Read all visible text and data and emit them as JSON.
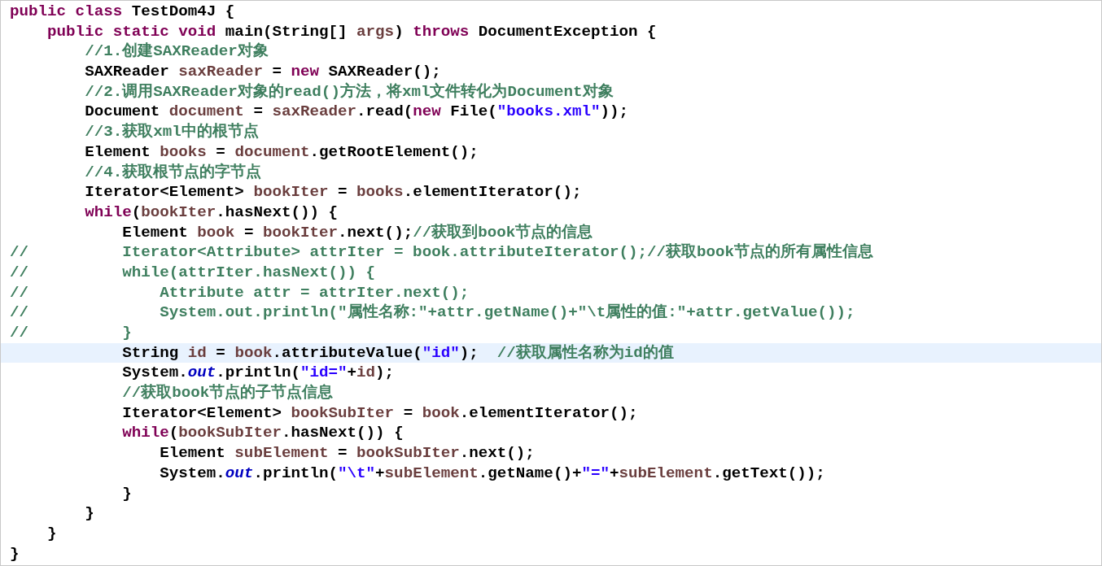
{
  "editor": {
    "lines": [
      {
        "current": false,
        "tokens": [
          {
            "kind": "keyword",
            "text": "public "
          },
          {
            "kind": "keyword",
            "text": "class"
          },
          {
            "kind": "plain",
            "text": " TestDom4J {"
          }
        ]
      },
      {
        "current": false,
        "tokens": [
          {
            "kind": "keyword",
            "text": "    public "
          },
          {
            "kind": "keyword",
            "text": "static "
          },
          {
            "kind": "keyword",
            "text": "void"
          },
          {
            "kind": "plain",
            "text": " main(String[] "
          },
          {
            "kind": "variable",
            "text": "args"
          },
          {
            "kind": "plain",
            "text": ") "
          },
          {
            "kind": "keyword",
            "text": "throws"
          },
          {
            "kind": "plain",
            "text": " DocumentException {"
          }
        ]
      },
      {
        "current": false,
        "tokens": [
          {
            "kind": "comment",
            "text": "        //1.创建SAXReader对象"
          }
        ]
      },
      {
        "current": false,
        "tokens": [
          {
            "kind": "plain",
            "text": "        SAXReader "
          },
          {
            "kind": "variable",
            "text": "saxReader"
          },
          {
            "kind": "plain",
            "text": " = "
          },
          {
            "kind": "keyword",
            "text": "new"
          },
          {
            "kind": "plain",
            "text": " SAXReader();"
          }
        ]
      },
      {
        "current": false,
        "tokens": [
          {
            "kind": "comment",
            "text": "        //2.调用SAXReader对象的read()方法，将xml文件转化为Document对象"
          }
        ]
      },
      {
        "current": false,
        "tokens": [
          {
            "kind": "plain",
            "text": "        Document "
          },
          {
            "kind": "variable",
            "text": "document"
          },
          {
            "kind": "plain",
            "text": " = "
          },
          {
            "kind": "variable",
            "text": "saxReader"
          },
          {
            "kind": "plain",
            "text": ".read("
          },
          {
            "kind": "keyword",
            "text": "new"
          },
          {
            "kind": "plain",
            "text": " File("
          },
          {
            "kind": "string",
            "text": "\"books.xml\""
          },
          {
            "kind": "plain",
            "text": "));"
          }
        ]
      },
      {
        "current": false,
        "tokens": [
          {
            "kind": "comment",
            "text": "        //3.获取xml中的根节点"
          }
        ]
      },
      {
        "current": false,
        "tokens": [
          {
            "kind": "plain",
            "text": "        Element "
          },
          {
            "kind": "variable",
            "text": "books"
          },
          {
            "kind": "plain",
            "text": " = "
          },
          {
            "kind": "variable",
            "text": "document"
          },
          {
            "kind": "plain",
            "text": ".getRootElement();"
          }
        ]
      },
      {
        "current": false,
        "tokens": [
          {
            "kind": "comment",
            "text": "        //4.获取根节点的字节点"
          }
        ]
      },
      {
        "current": false,
        "tokens": [
          {
            "kind": "plain",
            "text": "        Iterator<Element> "
          },
          {
            "kind": "variable",
            "text": "bookIter"
          },
          {
            "kind": "plain",
            "text": " = "
          },
          {
            "kind": "variable",
            "text": "books"
          },
          {
            "kind": "plain",
            "text": ".elementIterator();"
          }
        ]
      },
      {
        "current": false,
        "tokens": [
          {
            "kind": "keyword",
            "text": "        while"
          },
          {
            "kind": "plain",
            "text": "("
          },
          {
            "kind": "variable",
            "text": "bookIter"
          },
          {
            "kind": "plain",
            "text": ".hasNext()) {"
          }
        ]
      },
      {
        "current": false,
        "tokens": [
          {
            "kind": "plain",
            "text": "            Element "
          },
          {
            "kind": "variable",
            "text": "book"
          },
          {
            "kind": "plain",
            "text": " = "
          },
          {
            "kind": "variable",
            "text": "bookIter"
          },
          {
            "kind": "plain",
            "text": ".next();"
          },
          {
            "kind": "comment",
            "text": "//获取到book节点的信息"
          }
        ]
      },
      {
        "current": false,
        "tokens": [
          {
            "kind": "comment",
            "text": "//          Iterator<Attribute> attrIter = book.attributeIterator();//获取book节点的所有属性信息"
          }
        ]
      },
      {
        "current": false,
        "tokens": [
          {
            "kind": "comment",
            "text": "//          while(attrIter.hasNext()) {"
          }
        ]
      },
      {
        "current": false,
        "tokens": [
          {
            "kind": "comment",
            "text": "//              Attribute attr = attrIter.next();"
          }
        ]
      },
      {
        "current": false,
        "tokens": [
          {
            "kind": "comment",
            "text": "//              System.out.println(\"属性名称:\"+attr.getName()+\"\\t属性的值:\"+attr.getValue());"
          }
        ]
      },
      {
        "current": false,
        "tokens": [
          {
            "kind": "comment",
            "text": "//          }"
          }
        ]
      },
      {
        "current": true,
        "tokens": [
          {
            "kind": "plain",
            "text": "            String "
          },
          {
            "kind": "variable",
            "text": "id"
          },
          {
            "kind": "plain",
            "text": " = "
          },
          {
            "kind": "variable",
            "text": "book"
          },
          {
            "kind": "plain",
            "text": ".attributeValue("
          },
          {
            "kind": "string",
            "text": "\"id\""
          },
          {
            "kind": "plain",
            "text": ");  "
          },
          {
            "kind": "comment",
            "text": "//获取属性名称为id的值"
          }
        ]
      },
      {
        "current": false,
        "tokens": [
          {
            "kind": "plain",
            "text": "            System."
          },
          {
            "kind": "field",
            "text": "out"
          },
          {
            "kind": "plain",
            "text": ".println("
          },
          {
            "kind": "string",
            "text": "\"id=\""
          },
          {
            "kind": "plain",
            "text": "+"
          },
          {
            "kind": "variable",
            "text": "id"
          },
          {
            "kind": "plain",
            "text": ");"
          }
        ]
      },
      {
        "current": false,
        "tokens": [
          {
            "kind": "comment",
            "text": "            //获取book节点的子节点信息"
          }
        ]
      },
      {
        "current": false,
        "tokens": [
          {
            "kind": "plain",
            "text": "            Iterator<Element> "
          },
          {
            "kind": "variable",
            "text": "bookSubIter"
          },
          {
            "kind": "plain",
            "text": " = "
          },
          {
            "kind": "variable",
            "text": "book"
          },
          {
            "kind": "plain",
            "text": ".elementIterator();"
          }
        ]
      },
      {
        "current": false,
        "tokens": [
          {
            "kind": "keyword",
            "text": "            while"
          },
          {
            "kind": "plain",
            "text": "("
          },
          {
            "kind": "variable",
            "text": "bookSubIter"
          },
          {
            "kind": "plain",
            "text": ".hasNext()) {"
          }
        ]
      },
      {
        "current": false,
        "tokens": [
          {
            "kind": "plain",
            "text": "                Element "
          },
          {
            "kind": "variable",
            "text": "subElement"
          },
          {
            "kind": "plain",
            "text": " = "
          },
          {
            "kind": "variable",
            "text": "bookSubIter"
          },
          {
            "kind": "plain",
            "text": ".next();"
          }
        ]
      },
      {
        "current": false,
        "tokens": [
          {
            "kind": "plain",
            "text": "                System."
          },
          {
            "kind": "field",
            "text": "out"
          },
          {
            "kind": "plain",
            "text": ".println("
          },
          {
            "kind": "string",
            "text": "\"\\t\""
          },
          {
            "kind": "plain",
            "text": "+"
          },
          {
            "kind": "variable",
            "text": "subElement"
          },
          {
            "kind": "plain",
            "text": ".getName()+"
          },
          {
            "kind": "string",
            "text": "\"=\""
          },
          {
            "kind": "plain",
            "text": "+"
          },
          {
            "kind": "variable",
            "text": "subElement"
          },
          {
            "kind": "plain",
            "text": ".getText());"
          }
        ]
      },
      {
        "current": false,
        "tokens": [
          {
            "kind": "plain",
            "text": "            }"
          }
        ]
      },
      {
        "current": false,
        "tokens": [
          {
            "kind": "plain",
            "text": "        }"
          }
        ]
      },
      {
        "current": false,
        "tokens": [
          {
            "kind": "plain",
            "text": "    }"
          }
        ]
      },
      {
        "current": false,
        "tokens": [
          {
            "kind": "plain",
            "text": "}"
          }
        ]
      }
    ]
  }
}
